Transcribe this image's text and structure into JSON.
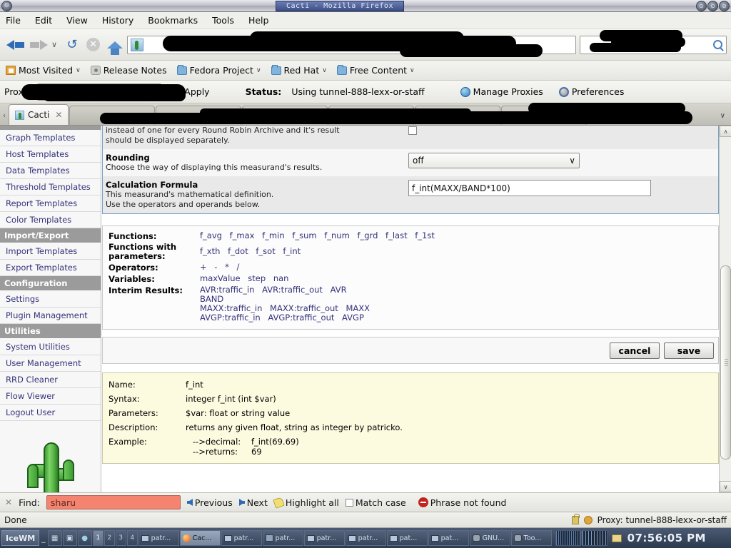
{
  "window": {
    "title": "Cacti - Mozilla Firefox",
    "minimize_label": "⊙",
    "maximize_label": "⊙",
    "close_label": "⊘",
    "left_button_label": "⊖"
  },
  "menubar": {
    "items": [
      {
        "label": "File",
        "accel": "F"
      },
      {
        "label": "Edit",
        "accel": "E"
      },
      {
        "label": "View",
        "accel": "V"
      },
      {
        "label": "History",
        "accel": "s"
      },
      {
        "label": "Bookmarks",
        "accel": "B"
      },
      {
        "label": "Tools",
        "accel": "T"
      },
      {
        "label": "Help",
        "accel": "H"
      }
    ]
  },
  "navbar": {
    "back_icon": "back-arrow-icon",
    "forward_icon": "forward-arrow-icon",
    "dropdown_icon": "chevron-down-icon",
    "reload_icon": "reload-icon",
    "stop_icon": "stop-icon",
    "home_icon": "home-icon",
    "url_value": "",
    "search_value": "",
    "search_icon": "search-icon"
  },
  "bookmarks": {
    "items": [
      {
        "label": "Most Visited",
        "icon": "most-visited-icon",
        "has_chevron": true
      },
      {
        "label": "Release Notes",
        "icon": "release-notes-icon",
        "has_chevron": false
      },
      {
        "label": "Fedora Project",
        "icon": "folder-icon",
        "has_chevron": true
      },
      {
        "label": "Red Hat",
        "icon": "folder-icon",
        "has_chevron": true
      },
      {
        "label": "Free Content",
        "icon": "folder-icon",
        "has_chevron": true
      }
    ],
    "chevron": "∨"
  },
  "proxybar": {
    "label": "Proxy:",
    "selected_value": "",
    "select_chevron": "∨",
    "apply_label": "Apply",
    "apply_check": "✓",
    "status_label": "Status:",
    "status_value": "Using tunnel-888-lexx-or-staff",
    "manage_proxies_label": "Manage Proxies",
    "preferences_label": "Preferences"
  },
  "tabs": {
    "scroll_left": "‹",
    "active": {
      "label": "Cacti",
      "close": "✕"
    },
    "new_tab": "✙",
    "list_all": "∨"
  },
  "sidebar": {
    "items": [
      {
        "label": "Graph Templates",
        "type": "link"
      },
      {
        "label": "Host Templates",
        "type": "link"
      },
      {
        "label": "Data Templates",
        "type": "link"
      },
      {
        "label": "Threshold Templates",
        "type": "link"
      },
      {
        "label": "Report Templates",
        "type": "link"
      },
      {
        "label": "Color Templates",
        "type": "link"
      },
      {
        "label": "Import/Export",
        "type": "header"
      },
      {
        "label": "Import Templates",
        "type": "link"
      },
      {
        "label": "Export Templates",
        "type": "link"
      },
      {
        "label": "Configuration",
        "type": "header"
      },
      {
        "label": "Settings",
        "type": "link"
      },
      {
        "label": "Plugin Management",
        "type": "link"
      },
      {
        "label": "Utilities",
        "type": "header"
      },
      {
        "label": "System Utilities",
        "type": "link"
      },
      {
        "label": "User Management",
        "type": "link"
      },
      {
        "label": "RRD Cleaner",
        "type": "link"
      },
      {
        "label": "Flow Viewer",
        "type": "link"
      },
      {
        "label": "Logout User",
        "type": "link"
      }
    ],
    "logo_name": "cacti-logo"
  },
  "form": {
    "cut_row_text_1": "instead of one for every Round Robin Archive and it's result",
    "cut_row_text_2": "should be displayed separately.",
    "rounding": {
      "label": "Rounding",
      "description": "Choose the way of displaying this measurand's results.",
      "value": "off",
      "chevron": "∨"
    },
    "formula": {
      "label": "Calculation Formula",
      "description_1": "This measurand's mathematical definition.",
      "description_2": "Use the operators and operands below.",
      "value": "f_int(MAXX/BAND*100)"
    }
  },
  "reference": {
    "rows": [
      {
        "label": "Functions:",
        "lines": [
          [
            "f_avg",
            "f_max",
            "f_min",
            "f_sum",
            "f_num",
            "f_grd",
            "f_last",
            "f_1st"
          ]
        ]
      },
      {
        "label": "Functions with parameters:",
        "lines": [
          [
            "f_xth",
            "f_dot",
            "f_sot",
            "f_int"
          ]
        ]
      },
      {
        "label": "Operators:",
        "lines": [
          [
            "+",
            "-",
            "*",
            "/"
          ]
        ]
      },
      {
        "label": "Variables:",
        "lines": [
          [
            "maxValue",
            "step",
            "nan"
          ]
        ]
      },
      {
        "label": "Interim Results:",
        "lines": [
          [
            "AVR:traffic_in",
            "AVR:traffic_out",
            "AVR"
          ],
          [
            "BAND"
          ],
          [
            "MAXX:traffic_in",
            "MAXX:traffic_out",
            "MAXX"
          ],
          [
            "AVGP:traffic_in",
            "AVGP:traffic_out",
            "AVGP"
          ]
        ]
      }
    ]
  },
  "actions": {
    "cancel_label": "cancel",
    "save_label": "save"
  },
  "help": {
    "rows": [
      {
        "label": "Name:",
        "value": "f_int"
      },
      {
        "label": "Syntax:",
        "value": "integer f_int (int $var)"
      },
      {
        "label": "Parameters:",
        "value": "$var: float or string value"
      },
      {
        "label": "Description:",
        "value": "returns any given float, string as integer by patricko."
      }
    ],
    "example_label": "Example:",
    "example_lines": [
      {
        "key": "-->decimal:",
        "val": "f_int(69.69)"
      },
      {
        "key": "-->returns:",
        "val": "69"
      }
    ]
  },
  "scrollbar": {
    "up_arrow": "∧",
    "down_arrow": "∨"
  },
  "findbar": {
    "close_icon": "close-icon",
    "close_glyph": "✕",
    "label": "Find:",
    "value": "sharu",
    "previous_label": "Previous",
    "next_label": "Next",
    "highlight_label": "Highlight all",
    "match_case_label": "Match case",
    "not_found_label": "Phrase not found"
  },
  "statusbar": {
    "status": "Done",
    "proxy_text": "Proxy: tunnel-888-lexx-or-staff"
  },
  "taskbar": {
    "start_label": "IceWM",
    "minimize_glyph": "_",
    "workspaces": [
      "1",
      "2",
      "3",
      "4"
    ],
    "active_workspace": "1",
    "tasks": [
      {
        "label": "patr...",
        "icon": "monitor-icon",
        "active": false
      },
      {
        "label": "Cac...",
        "icon": "firefox-icon",
        "active": true
      },
      {
        "label": "patr...",
        "icon": "monitor-icon",
        "active": false
      },
      {
        "label": "patr...",
        "icon": "key-icon",
        "active": false
      },
      {
        "label": "patr...",
        "icon": "monitor-icon",
        "active": false
      },
      {
        "label": "patr...",
        "icon": "monitor-icon",
        "active": false
      },
      {
        "label": "pat...",
        "icon": "monitor-icon",
        "active": false
      },
      {
        "label": "pat...",
        "icon": "monitor-icon",
        "active": false
      },
      {
        "label": "GNU...",
        "icon": "gnu-icon",
        "active": false
      },
      {
        "label": "Too...",
        "icon": "gnu-icon",
        "active": false
      }
    ],
    "clock": "07:56:05 PM"
  },
  "colors": {
    "link": "#33337a",
    "header_bg": "#9b9b9b",
    "help_bg": "#fcfadf",
    "find_error": "#f4836f",
    "accent": "#2f6cb5"
  }
}
